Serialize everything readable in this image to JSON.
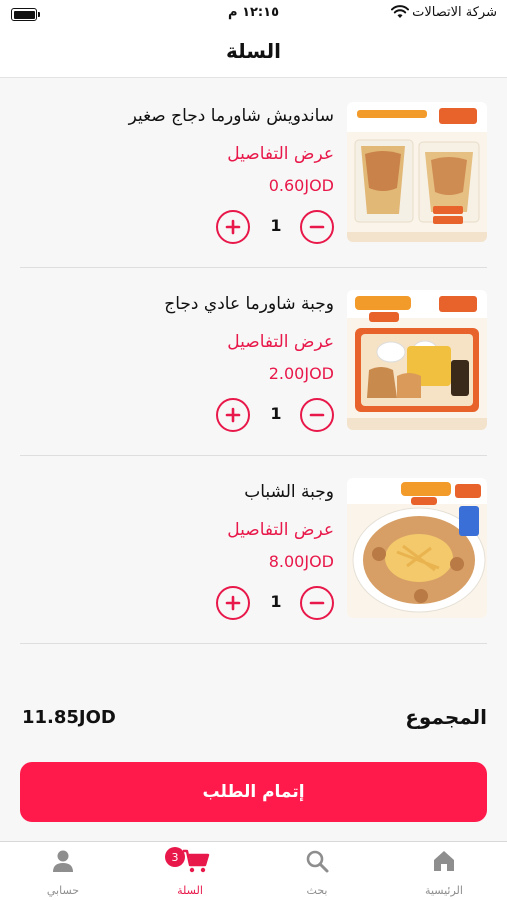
{
  "status_bar": {
    "carrier": "شركة الاتصالات",
    "time": "١٢:١٥ م"
  },
  "header": {
    "title": "السلة"
  },
  "cart": {
    "items": [
      {
        "name": "ساندويش شاورما دجاج صغير",
        "details_label": "عرض التفاصيل",
        "price": "0.60JOD",
        "quantity": "1"
      },
      {
        "name": "وجبة شاورما عادي دجاج",
        "details_label": "عرض التفاصيل",
        "price": "2.00JOD",
        "quantity": "1"
      },
      {
        "name": "وجبة الشباب",
        "details_label": "عرض التفاصيل",
        "price": "8.00JOD",
        "quantity": "1"
      }
    ]
  },
  "summary": {
    "total_label": "المجموع",
    "total_value": "11.85JOD"
  },
  "checkout": {
    "label": "إتمام الطلب"
  },
  "tabs": [
    {
      "label": "الرئيسية",
      "icon": "home-icon"
    },
    {
      "label": "بحث",
      "icon": "search-icon"
    },
    {
      "label": "السلة",
      "icon": "cart-icon",
      "badge": "3"
    },
    {
      "label": "حسابي",
      "icon": "person-icon"
    }
  ],
  "colors": {
    "accent": "#e8184a",
    "button": "#ff1a4b",
    "inactive": "#8e8e8e"
  }
}
